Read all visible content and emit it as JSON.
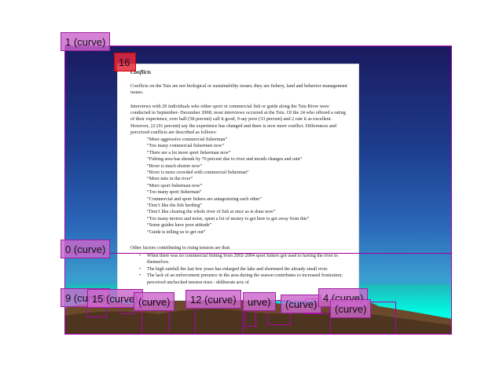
{
  "colors": {
    "annotation_fill": "#cc66cc",
    "annotation_border": "#a020a0",
    "highlight_red": "#e6283c",
    "sky_top": "#1a1a5e",
    "sea": "#00ffe6"
  },
  "document": {
    "title": "Conflicts",
    "para1": "Conflicts on the Tsiu are not biological or sustainability issues; they are fishery, land and behavior management issues.",
    "para2": "Interviews with 29 individuals who either sport or commercial fish or guide along the Tsiu River were conducted in September- December 2008; most interviews occurred at the Tsiu. Of the 24 who offered a rating of their experience, over half (58 percent) call it good, 9 say poor (33 percent) and 2 rate it as excellent. However, 22 (91 percent) say the experience has changed and there is now more conflict. Differences and perceived conflicts are described as follows:",
    "quotes": [
      "“More aggressive commercial fisherman”",
      "“Too many commercial fishermen now”",
      "“There are a lot more sport fisherman now”",
      "“Fishing area has shrunk by 70 percent due to river and mouth changes and rain”",
      "“River is much shorter now”",
      "“River is more crowded with commercial fisherman”",
      "“More nets in the river”",
      "“More sport fisherman now”",
      "“Too many sport fisherman”",
      "“Commercial and sport fishers are antagonizing each other”",
      "“Don’t like the fish herding”",
      "“Don’t like clearing the whole river of fish at once as is done now”",
      "“Too many motors and noise, spent a lot of money to get here to get away from this”",
      "“Some guides have poor attitude”",
      "“Guide is telling us to get out”"
    ],
    "para3": "Other factors contributing to rising tension are that:",
    "bullets": [
      "When there was no commercial fishing from 2002-2004 sport fishers got used to having the river to themselves.",
      "The high rainfall the last few years has enlarged the lake and shortened the already small river.",
      "The lack of an enforcement presence in the area during the season contributes to increased frustration; perceived unchecked tension rises - deliberate acts of"
    ]
  },
  "annotations": {
    "curve_1": "1 (curve)",
    "curve_16": "16",
    "curve_0": "0 (curve)",
    "curve_9": "9 (curve)",
    "curve_15": "15 (curve)",
    "curve_12": "12 (curve)",
    "curve_4": "4 (curve)",
    "frag_curve_a": "(curve)",
    "frag_curve_b": "(curve)",
    "frag_curve_c": "urve)",
    "frag_curve_d": "(curve)"
  }
}
